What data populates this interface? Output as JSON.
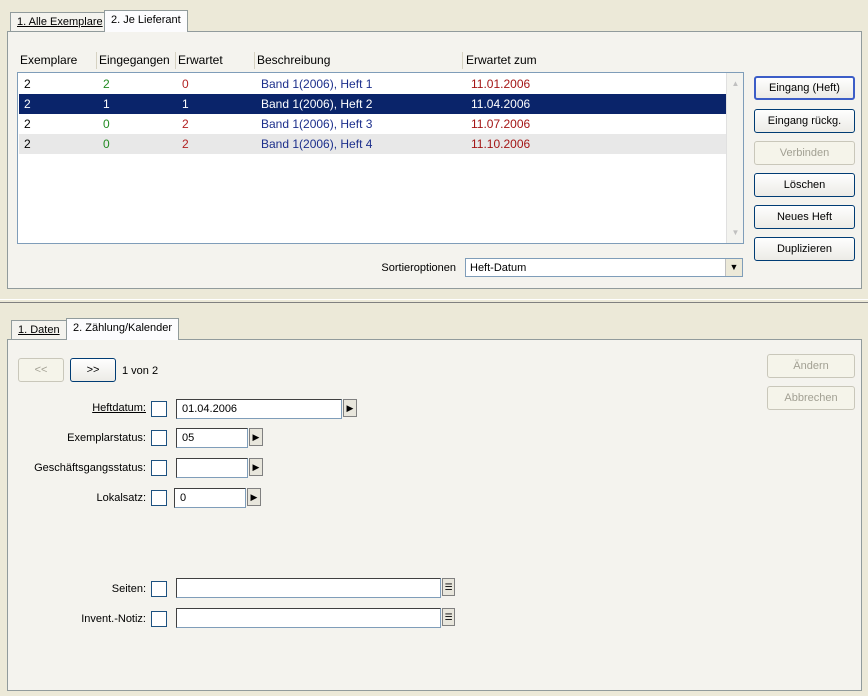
{
  "top_tabs": [
    {
      "label": "1. Alle Exemplare",
      "active": false
    },
    {
      "label": "2. Je Lieferant",
      "active": true
    }
  ],
  "list": {
    "columns": [
      "Exemplare",
      "Eingegangen",
      "Erwartet",
      "Beschreibung",
      "Erwartet zum"
    ],
    "rows": [
      {
        "exemplare": "2",
        "eingegangen": "2",
        "erwartet": "0",
        "beschreibung": "Band 1(2006), Heft 1",
        "erwartet_zum": "11.01.2006"
      },
      {
        "exemplare": "2",
        "eingegangen": "1",
        "erwartet": "1",
        "beschreibung": "Band 1(2006), Heft 2",
        "erwartet_zum": "11.04.2006"
      },
      {
        "exemplare": "2",
        "eingegangen": "0",
        "erwartet": "2",
        "beschreibung": "Band 1(2006), Heft 3",
        "erwartet_zum": "11.07.2006"
      },
      {
        "exemplare": "2",
        "eingegangen": "0",
        "erwartet": "2",
        "beschreibung": "Band 1(2006), Heft 4",
        "erwartet_zum": "11.10.2006"
      }
    ]
  },
  "side_buttons": {
    "eingang": "Eingang (Heft)",
    "eingang_rueck": "Eingang rückg.",
    "verbinden": "Verbinden",
    "loeschen": "Löschen",
    "neues_heft": "Neues Heft",
    "duplizieren": "Duplizieren"
  },
  "sort": {
    "label": "Sortieroptionen",
    "value": "Heft-Datum"
  },
  "bottom_tabs": [
    {
      "label": "1. Daten",
      "active": false
    },
    {
      "label": "2. Zählung/Kalender",
      "active": true
    }
  ],
  "nav": {
    "prev": "<<",
    "next": ">>",
    "counter": "1 von 2"
  },
  "action_buttons": {
    "aendern": "Ändern",
    "abbrechen": "Abbrechen"
  },
  "form": {
    "heftdatum_label": "Heftdatum:",
    "heftdatum_value": "01.04.2006",
    "exemplarstatus_label": "Exemplarstatus:",
    "exemplarstatus_value": "05",
    "geschaeftsgang_label": "Geschäftsgangsstatus:",
    "geschaeftsgang_value": "",
    "lokalsatz_label": "Lokalsatz:",
    "lokalsatz_value": "0",
    "seiten_label": "Seiten:",
    "seiten_value": "",
    "invent_label": "Invent.-Notiz:",
    "invent_value": ""
  },
  "colors": {
    "selection": "#0a246a",
    "received": "#228b22",
    "expected": "#b22222",
    "description": "#1c2f8c",
    "date": "#a31515"
  }
}
